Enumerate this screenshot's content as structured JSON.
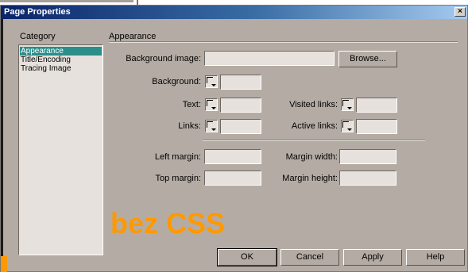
{
  "window": {
    "title": "Page Properties",
    "close_glyph": "×"
  },
  "category": {
    "heading": "Category",
    "items": [
      "Appearance",
      "Title/Encoding",
      "Tracing Image"
    ],
    "selected_index": 0
  },
  "panel": {
    "heading": "Appearance",
    "background_image_label": "Background image:",
    "background_image_value": "",
    "browse_label": "Browse...",
    "background_label": "Background:",
    "text_label": "Text:",
    "visited_links_label": "Visited links:",
    "links_label": "Links:",
    "active_links_label": "Active links:",
    "left_margin_label": "Left margin:",
    "margin_width_label": "Margin width:",
    "top_margin_label": "Top margin:",
    "margin_height_label": "Margin height:"
  },
  "overlay_text": "bez CSS",
  "buttons": {
    "ok": "OK",
    "cancel": "Cancel",
    "apply": "Apply",
    "help": "Help"
  },
  "colors": {
    "dialog_bg": "#b4aca4",
    "selection": "#2a8f8a",
    "overlay": "#ff9900",
    "title_start": "#0a246a"
  }
}
